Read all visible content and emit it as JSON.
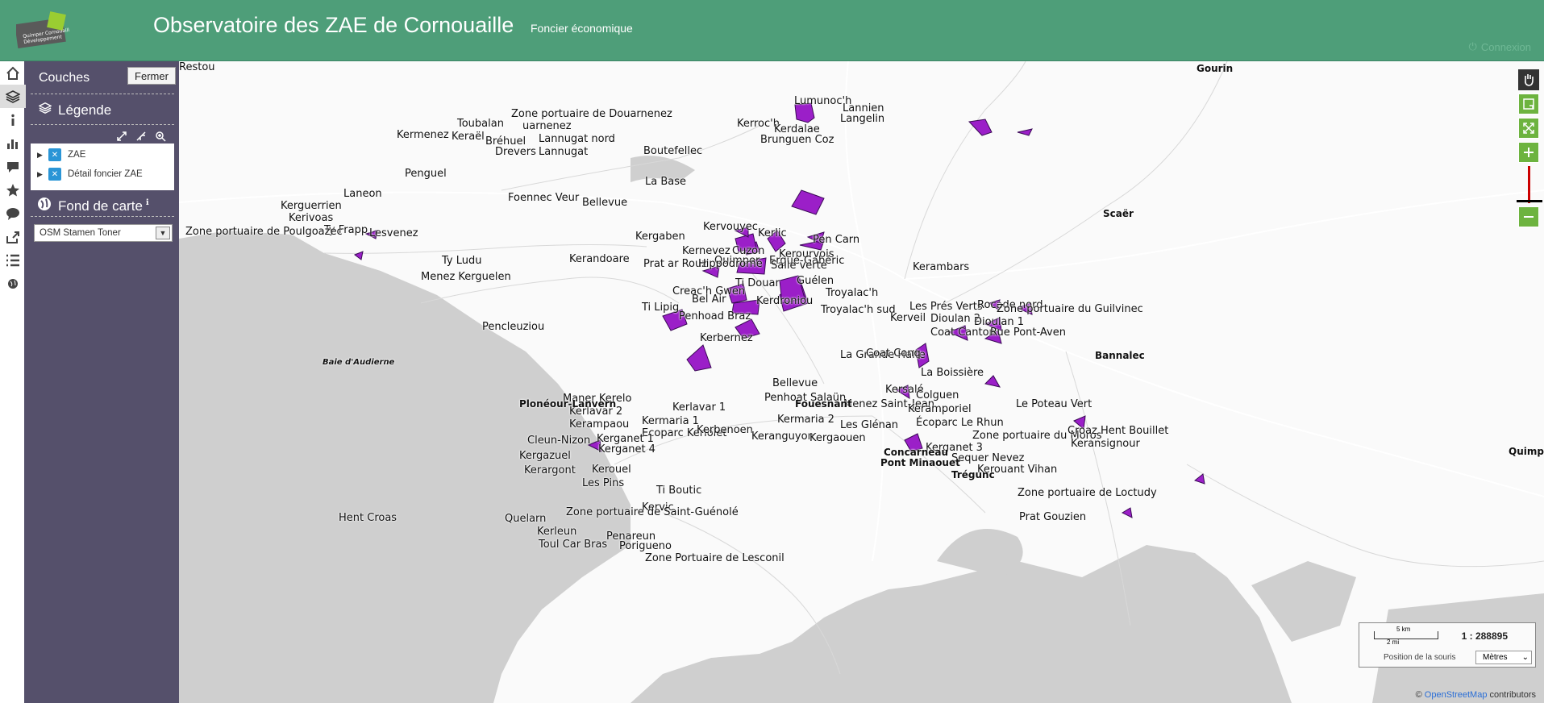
{
  "header": {
    "title": "Observatoire des ZAE de Cornouaille",
    "subtitle": "Foncier économique",
    "login": "Connexion",
    "logo_text": "Quimper Cornouaille Développement"
  },
  "toolbar": {
    "items": [
      "home-icon",
      "layers-icon",
      "info-icon",
      "chart-icon",
      "comment-icon",
      "star-icon",
      "chat-icon",
      "share-icon",
      "list-icon",
      "globe-icon"
    ]
  },
  "panel": {
    "title": "Couches",
    "close": "Fermer",
    "legend": "Légende",
    "layers": [
      {
        "label": "ZAE",
        "checked": true
      },
      {
        "label": "Détail foncier ZAE",
        "checked": true
      }
    ],
    "basemap_title": "Fond de carte",
    "basemap_selected": "OSM Stamen Toner"
  },
  "map": {
    "sea_label": "Baie d'Audierne",
    "labels": [
      "Zone portuaire de Douarnenez",
      "Toubalan",
      "uarnenez",
      "Kermenez",
      "Keraël",
      "Bréhuel",
      "Lannugat nord",
      "Drevers",
      "Lannugat",
      "Boutefellec",
      "Lumunoc'h",
      "Lannien",
      "Langelin",
      "Kerroc'h",
      "Kerdalae",
      "Brunguen Coz",
      "Penguel",
      "La Base",
      "Laneon",
      "Foennec Veur",
      "Bellevue",
      "Kerguerrien",
      "Kerivoas",
      "Ty Frapp",
      "Zone portuaire de Poulgoazec",
      "Lesvenez",
      "Kervouyec",
      "Kerlic",
      "Pen Carn",
      "Kergaben",
      "Kernevez",
      "Cuzon",
      "Kerourvois",
      "Quimper",
      "Ergué-Gabéric",
      "Ty Ludu",
      "Kerandoare",
      "Prat ar Rouz",
      "Hippodrome",
      "Salle verte",
      "Kerambars",
      "Menez Kerguelen",
      "Creac'h Gwen",
      "Ti Douar",
      "Guélen",
      "Troyalac'h",
      "Bel Air",
      "Kerdroniou",
      "Ti Lipig",
      "Troyalac'h sud",
      "Penhoad Braz",
      "Les Prés Verts",
      "Rocade nord",
      "Kerveil",
      "Dioulan 2",
      "Dioulan 1",
      "Coat Canton",
      "Rue Pont-Aven",
      "Pencleuziou",
      "Kerbernez",
      "La Grande Halte",
      "Coat Conq",
      "La Boissière",
      "Bellevue",
      "Kersalé",
      "Colguen",
      "Penhoat Salaün",
      "Maner Kerelo",
      "Kerlavar 2",
      "Kerlavar 1",
      "Menez Saint-Jean",
      "Keramporiel",
      "Le Poteau Vert",
      "Kerampaou",
      "Kermaria 1",
      "Kermaria 2",
      "Les Glénan",
      "Écoparc Le Rhun",
      "Ecoparc Keriolet",
      "Kerbenoen",
      "Keranguyon",
      "Kergaouen",
      "Zone portuaire du Moros",
      "Croaz Hent Bouillet",
      "Cleun-Nizon",
      "Kerganet 1",
      "Kerganet 4",
      "Kerganet 3",
      "Keransignour",
      "Kergazuel",
      "Sequer Nevez",
      "Kerouel",
      "Kerargont",
      "Kerouant Vihan",
      "Les Pins",
      "Ti Boutic",
      "Zone portuaire de Loctudy",
      "Kervic",
      "Hent Croas",
      "Zone portuaire de Saint-Guénolé",
      "Quelarn",
      "Prat Gouzien",
      "Kerleun",
      "Toul Car Bras",
      "Penareun",
      "Porigueno",
      "Zone Portuaire de Lesconil",
      "Zone portuaire du Guilvinec",
      "Restou"
    ],
    "towns": [
      "Gourin",
      "Scaër",
      "Bannalec",
      "Plonéour-Lanvern",
      "Fouesnant",
      "Concarneau",
      "Pont Minaouet",
      "Trégunc",
      "Quimper"
    ]
  },
  "scale": {
    "ratio": "1 : 288895",
    "km": "5 km",
    "mi": "2 mi",
    "mouse_position": "Position de la souris",
    "unit": "Mètres"
  },
  "attribution": {
    "prefix": "©",
    "link": "OpenStreetMap",
    "suffix": "contributors"
  },
  "colors": {
    "header": "#4e9e79",
    "panel": "#55506b",
    "zae": "#9b1fc8",
    "control": "#6db33f"
  }
}
